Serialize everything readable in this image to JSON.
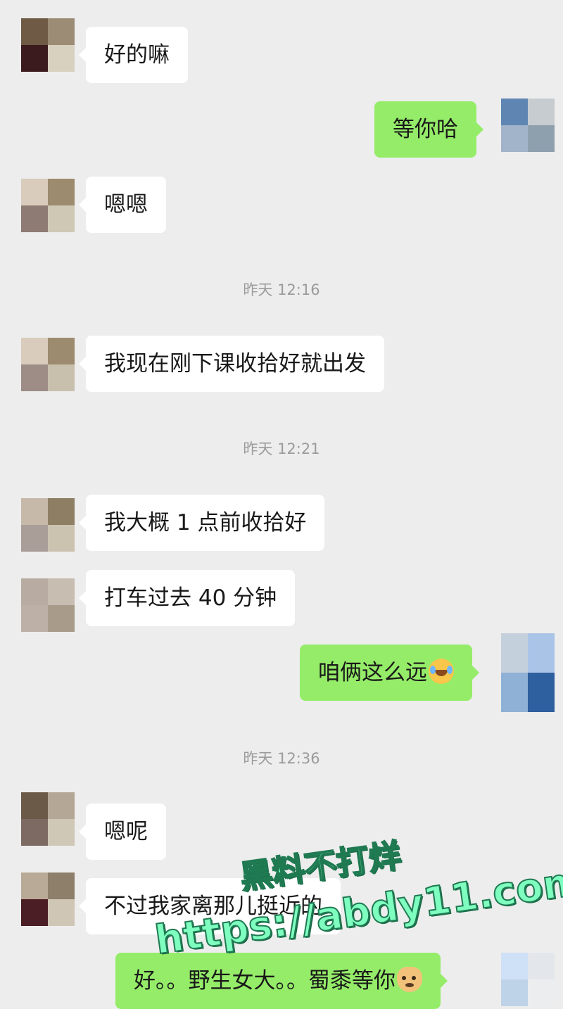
{
  "messages": [
    {
      "kind": "in",
      "text": "好的嘛",
      "avatar": [
        "#6e5a45",
        "#9c8c76",
        "#3b1b1d",
        "#d8d1c0"
      ]
    },
    {
      "kind": "out",
      "text": "等你哈",
      "avatar": [
        "#5f86b3",
        "#c7ccd0",
        "#a1b4c9",
        "#8ea0ae"
      ]
    },
    {
      "kind": "in",
      "text": "嗯嗯",
      "avatar": [
        "#d9ccbc",
        "#9c8b6e",
        "#8e7b73",
        "#cfc8b4"
      ]
    },
    {
      "kind": "time",
      "text": "昨天 12:16"
    },
    {
      "kind": "in",
      "text": "我现在刚下课收拾好就出发",
      "avatar": [
        "#d9ccbc",
        "#9c8b6e",
        "#9e8c86",
        "#c8c0ac"
      ]
    },
    {
      "kind": "time",
      "text": "昨天 12:21"
    },
    {
      "kind": "in",
      "text": "我大概 1 点前收拾好",
      "avatar": [
        "#c6b9a9",
        "#8e7e63",
        "#a99e98",
        "#cbc3b0"
      ]
    },
    {
      "kind": "in",
      "text": "打车过去 40 分钟",
      "avatar": [
        "#b8aca2",
        "#c8bdb1",
        "#bdb0a7",
        "#a99b89"
      ]
    },
    {
      "kind": "out",
      "text": "咱俩这么远",
      "emoji": "laughing-crying-emoji",
      "avatar": [
        "#c4d0dc",
        "#a9c4e6",
        "#8fb1d6",
        "#e8ecef"
      ]
    },
    {
      "kind": "time",
      "text": "昨天 12:36"
    },
    {
      "kind": "in",
      "text": "嗯呢",
      "avatar": [
        "#6b5a48",
        "#b4a795",
        "#7d6a63",
        "#d0c8b6"
      ]
    },
    {
      "kind": "in",
      "text": "不过我家离那儿挺近的",
      "avatar": [
        "#b8aa96",
        "#8e7f6a",
        "#4a1e24",
        "#cfc6b5"
      ]
    },
    {
      "kind": "out",
      "text": "好。。野生女大。。蜀黍等你",
      "emoji": "doge-emoji",
      "avatar": [
        "#cfe1f6",
        "#e3e6ea",
        "#bfd3e8",
        "#ebedef"
      ]
    }
  ],
  "watermark": {
    "line1": "黑料不打烊",
    "line2": "https://abdy11.com"
  }
}
